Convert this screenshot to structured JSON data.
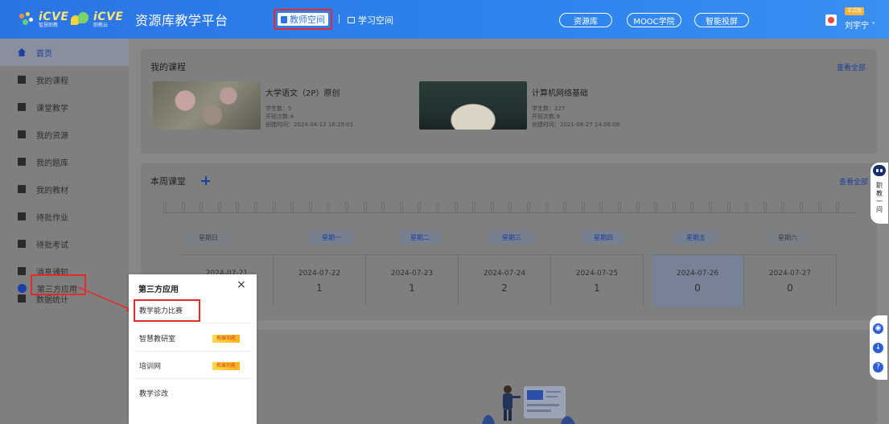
{
  "header": {
    "logo1": {
      "brand": "iCVE",
      "sub": "智慧职教"
    },
    "logo2": {
      "brand": "iCVE",
      "sub": "职教云"
    },
    "platform_title": "资源库教学平台",
    "tab_teacher": "教师空间",
    "tab_study": "学习空间",
    "pill_resource": "资源库",
    "pill_mooc": "MOOC学院",
    "pill_screen": "智能投屏",
    "vip_tag": "正式版",
    "user_name": "刘宇宁 ˅"
  },
  "sidebar": {
    "items": [
      {
        "label": "首页",
        "icon": "home-icon"
      },
      {
        "label": "我的课程",
        "icon": "course-icon"
      },
      {
        "label": "课堂教学",
        "icon": "classroom-icon"
      },
      {
        "label": "我的资源",
        "icon": "resource-icon"
      },
      {
        "label": "我的题库",
        "icon": "question-bank-icon"
      },
      {
        "label": "我的教材",
        "icon": "textbook-icon"
      },
      {
        "label": "待批作业",
        "icon": "homework-icon"
      },
      {
        "label": "待批考试",
        "icon": "exam-icon"
      },
      {
        "label": "消息通知",
        "icon": "message-icon"
      },
      {
        "label": "数据统计",
        "icon": "stats-icon"
      },
      {
        "label": "第三方应用",
        "icon": "apps-icon"
      }
    ]
  },
  "courses_section": {
    "title": "我的课程",
    "see_all": "查看全部",
    "courses": [
      {
        "name": "大学语文（2P）原创",
        "students": "学生数：5",
        "sessions": "开班次数:4",
        "created": "创建时间：2024-04-12 16:29:01"
      },
      {
        "name": "计算机网络基础",
        "students": "学生数：227",
        "sessions": "开班次数:9",
        "created": "创建时间：2021-08-27 14:08:08"
      }
    ]
  },
  "week_section": {
    "title": "本周课堂",
    "see_all": "查看全部",
    "days": [
      {
        "weekday": "星期日",
        "date": "2024-07-21",
        "count": ""
      },
      {
        "weekday": "星期一",
        "date": "2024-07-22",
        "count": "1"
      },
      {
        "weekday": "星期二",
        "date": "2024-07-23",
        "count": "1"
      },
      {
        "weekday": "星期三",
        "date": "2024-07-24",
        "count": "2"
      },
      {
        "weekday": "星期四",
        "date": "2024-07-25",
        "count": "1"
      },
      {
        "weekday": "星期五",
        "date": "2024-07-26",
        "count": "0"
      },
      {
        "weekday": "星期六",
        "date": "2024-07-27",
        "count": "0"
      }
    ]
  },
  "popup": {
    "title": "第三方应用",
    "close": "×",
    "items": [
      {
        "label": "教学能力比赛",
        "tag": ""
      },
      {
        "label": "智慧教研室",
        "tag": "拓展功能"
      },
      {
        "label": "培训网",
        "tag": "拓展功能"
      },
      {
        "label": "教学诊改",
        "tag": ""
      }
    ]
  },
  "float_helper": {
    "text": "职教一问"
  },
  "tools": [
    "feedback-icon",
    "download-icon",
    "help-icon"
  ],
  "colors": {
    "header": "#2b74e4",
    "highlight": "#e52a2a",
    "accent": "#1a3f9c",
    "tag": "#ffc534"
  }
}
